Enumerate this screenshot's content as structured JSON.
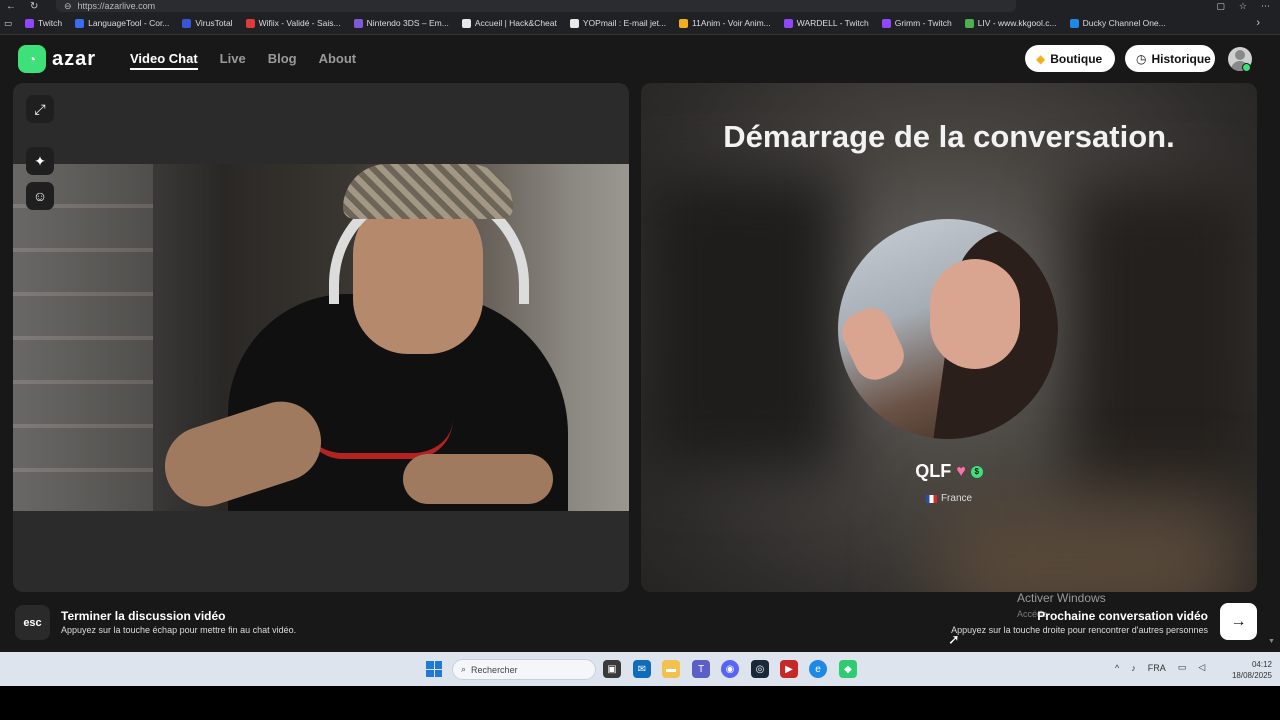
{
  "browser": {
    "url": "https://azarlive.com",
    "bookmarks": [
      {
        "label": "Twitch",
        "color": "#9146ff"
      },
      {
        "label": "LanguageTool - Cor...",
        "color": "#3a6df0"
      },
      {
        "label": "VirusTotal",
        "color": "#3954d6"
      },
      {
        "label": "Wifiix - Validé - Sais...",
        "color": "#e03a3a"
      },
      {
        "label": "Nintendo 3DS – Em...",
        "color": "#7b5cd6"
      },
      {
        "label": "Accueil | Hack&Cheat",
        "color": "#e8e8e8"
      },
      {
        "label": "YOPmail : E-mail jet...",
        "color": "#e8e8e8"
      },
      {
        "label": "11Anim - Voir Anim...",
        "color": "#f2b01e"
      },
      {
        "label": "WARDELL - Twitch",
        "color": "#9146ff"
      },
      {
        "label": "Grimm - Twitch",
        "color": "#9146ff"
      },
      {
        "label": "LIV - www.kkgool.c...",
        "color": "#4caf50"
      },
      {
        "label": "Ducky Channel One...",
        "color": "#1e88e5"
      }
    ]
  },
  "site": {
    "logo": "azar",
    "nav": [
      {
        "label": "Video Chat",
        "active": true
      },
      {
        "label": "Live",
        "active": false
      },
      {
        "label": "Blog",
        "active": false
      },
      {
        "label": "About",
        "active": false
      }
    ],
    "boutique_label": "Boutique",
    "historique_label": "Historique"
  },
  "match": {
    "status_title": "Démarrage de la conversation.",
    "name": "QLF",
    "country": "France"
  },
  "controls": {
    "esc_key": "esc",
    "end_title": "Terminer la discussion vidéo",
    "end_desc": "Appuyez sur la touche échap pour mettre fin au chat vidéo.",
    "next_title": "Prochaine conversation vidéo",
    "next_desc": "Appuyez sur la touche droite pour rencontrer d'autres personnes"
  },
  "os": {
    "activate_title": "Activer Windows",
    "activate_sub": "Accéde",
    "search_placeholder": "Rechercher",
    "lang": "FRA",
    "time": "04:12",
    "date": "18/08/2025"
  },
  "colors": {
    "accent": "#3ee07a",
    "bg": "#181818"
  }
}
